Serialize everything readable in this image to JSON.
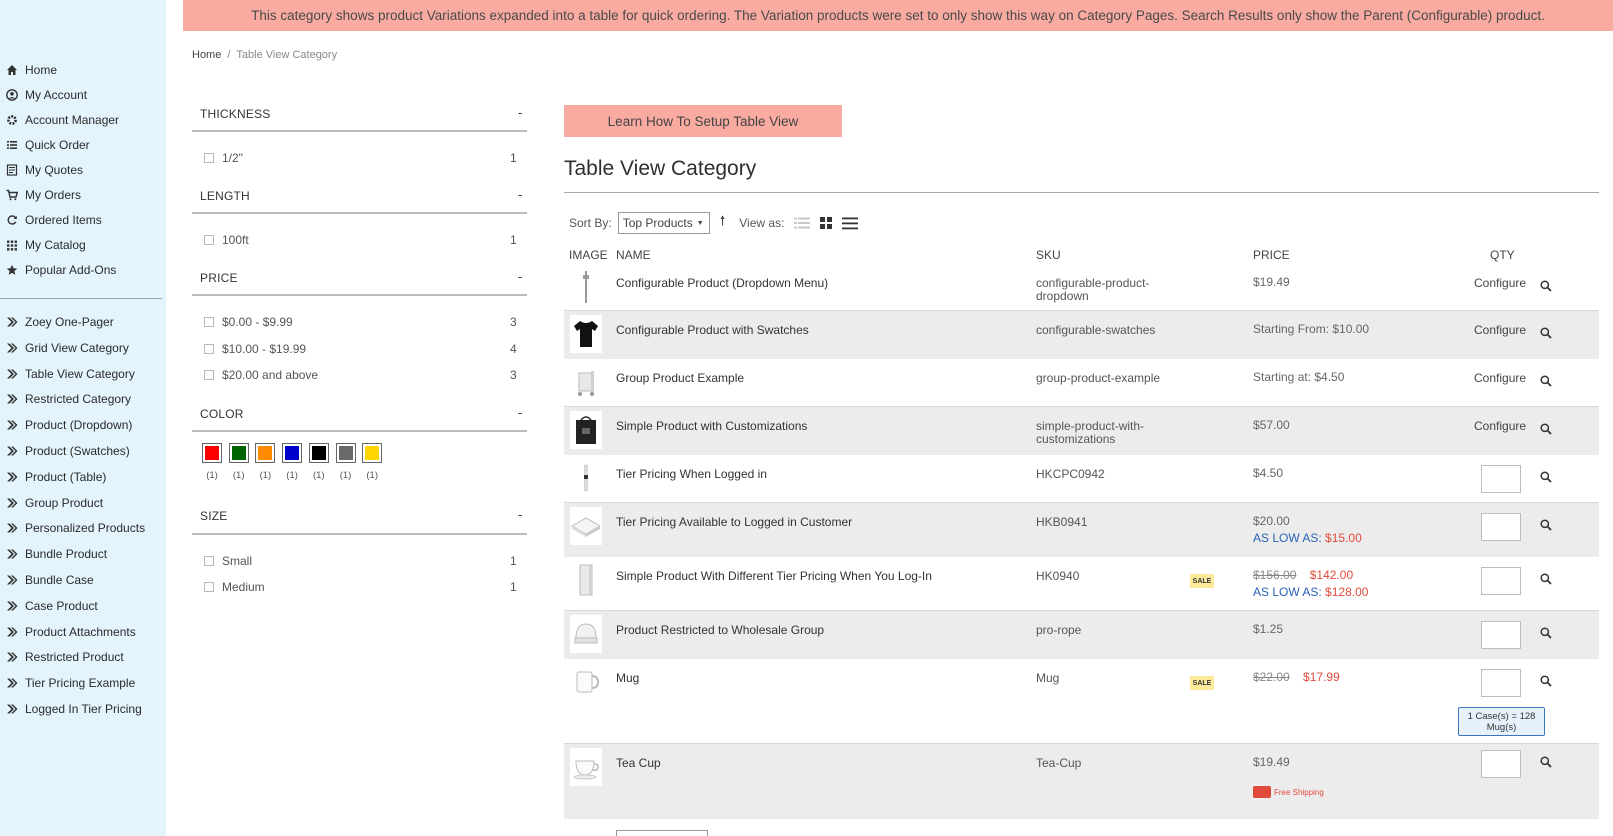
{
  "banner": {
    "text": "This category shows product Variations expanded into a table for quick ordering. The Variation products were set to only show this way on Category Pages. Search Results only show the Parent (Configurable) product."
  },
  "breadcrumb": {
    "home": "Home",
    "sep": "/",
    "current": "Table View Category"
  },
  "sidebar": {
    "items": [
      {
        "label": "Home",
        "icon": "home-icon"
      },
      {
        "label": "My Account",
        "icon": "user-icon"
      },
      {
        "label": "Account Manager",
        "icon": "gear-icon"
      },
      {
        "label": "Quick Order",
        "icon": "list-icon"
      },
      {
        "label": "My Quotes",
        "icon": "quote-icon"
      },
      {
        "label": "My Orders",
        "icon": "cart-icon"
      },
      {
        "label": "Ordered Items",
        "icon": "refresh-icon"
      },
      {
        "label": "My Catalog",
        "icon": "grid-icon"
      },
      {
        "label": "Popular Add-Ons",
        "icon": "star-icon"
      }
    ],
    "categories": [
      "Zoey One-Pager",
      "Grid View Category",
      "Table View Category",
      "Restricted Category",
      "Product (Dropdown)",
      "Product (Swatches)",
      "Product (Table)",
      "Group Product",
      "Personalized Products",
      "Bundle Product",
      "Bundle Case",
      "Case Product",
      "Product Attachments",
      "Restricted Product",
      "Tier Pricing Example",
      "Logged In Tier Pricing"
    ]
  },
  "filters": {
    "thickness": {
      "title": "THICKNESS",
      "toggle": "-",
      "options": [
        {
          "label": "1/2\"",
          "count": "1"
        }
      ]
    },
    "length": {
      "title": "LENGTH",
      "toggle": "-",
      "options": [
        {
          "label": "100ft",
          "count": "1"
        }
      ]
    },
    "price": {
      "title": "PRICE",
      "toggle": "-",
      "options": [
        {
          "label": "$0.00 - $9.99",
          "count": "3"
        },
        {
          "label": "$10.00 - $19.99",
          "count": "4"
        },
        {
          "label": "$20.00 and above",
          "count": "3"
        }
      ]
    },
    "color": {
      "title": "COLOR",
      "toggle": "-",
      "swatches": [
        {
          "color": "#ff0000",
          "count": "(1)"
        },
        {
          "color": "#006400",
          "count": "(1)"
        },
        {
          "color": "#ff8c00",
          "count": "(1)"
        },
        {
          "color": "#0000cd",
          "count": "(1)"
        },
        {
          "color": "#000000",
          "count": "(1)"
        },
        {
          "color": "#696969",
          "count": "(1)"
        },
        {
          "color": "#ffd700",
          "count": "(1)"
        }
      ]
    },
    "size": {
      "title": "SIZE",
      "toggle": "-",
      "options": [
        {
          "label": "Small",
          "count": "1"
        },
        {
          "label": "Medium",
          "count": "1"
        }
      ]
    }
  },
  "main": {
    "learn_button": "Learn How To Setup Table View",
    "title": "Table View Category",
    "sort_label": "Sort By:",
    "sort_value": "Top Products",
    "view_as": "View as:",
    "headers": {
      "image": "IMAGE",
      "name": "NAME",
      "sku": "SKU",
      "price": "PRICE",
      "qty": "QTY"
    },
    "products": [
      {
        "name": "Configurable Product (Dropdown Menu)",
        "sku": "configurable-product-dropdown",
        "price": "$19.49",
        "action": "Configure"
      },
      {
        "name": "Configurable Product with Swatches",
        "sku": "configurable-swatches",
        "price": "Starting From: $10.00",
        "action": "Configure"
      },
      {
        "name": "Group Product Example",
        "sku": "group-product-example",
        "price": "Starting at: $4.50",
        "action": "Configure"
      },
      {
        "name": "Simple Product with Customizations",
        "sku": "simple-product-with-customizations",
        "price": "$57.00",
        "action": "Configure"
      },
      {
        "name": "Tier Pricing When Logged in",
        "sku": "HKCPC0942",
        "price": "$4.50"
      },
      {
        "name": "Tier Pricing Available to Logged in Customer",
        "sku": "HKB0941",
        "price": "$20.00",
        "price_low": "AS LOW AS:",
        "price_low_value": "$15.00"
      },
      {
        "name": "Simple Product With Different Tier Pricing When You Log-In",
        "sku": "HK0940",
        "badge": "SALE",
        "price_old": "$156.00",
        "price_new": "$142.00",
        "price_low": "AS LOW AS:",
        "price_low_value": "$128.00"
      },
      {
        "name": "Product Restricted to Wholesale Group",
        "sku": "pro-rope",
        "price": "$1.25"
      },
      {
        "name": "Mug",
        "sku": "Mug",
        "badge": "SALE",
        "price_old": "$22.00",
        "price_new": "$17.99",
        "case_note": "1 Case(s) = 128 Mug(s)"
      },
      {
        "name": "Tea Cup",
        "sku": "Tea-Cup",
        "price": "$19.49",
        "free_shipping": "Free Shipping"
      }
    ]
  }
}
